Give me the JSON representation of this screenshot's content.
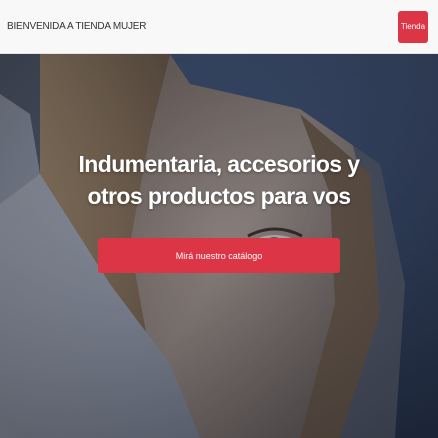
{
  "navbar": {
    "brand": "BIENVENIDA A TIENDA MUJER",
    "button_label": "Tienda"
  },
  "hero": {
    "title": "Indumentaria, accesorios y otros productos para vos",
    "cta_label": "Mirá nuestro catálogo"
  },
  "colors": {
    "accent": "#dc3545",
    "navbar_bg": "#f8f8f8"
  }
}
